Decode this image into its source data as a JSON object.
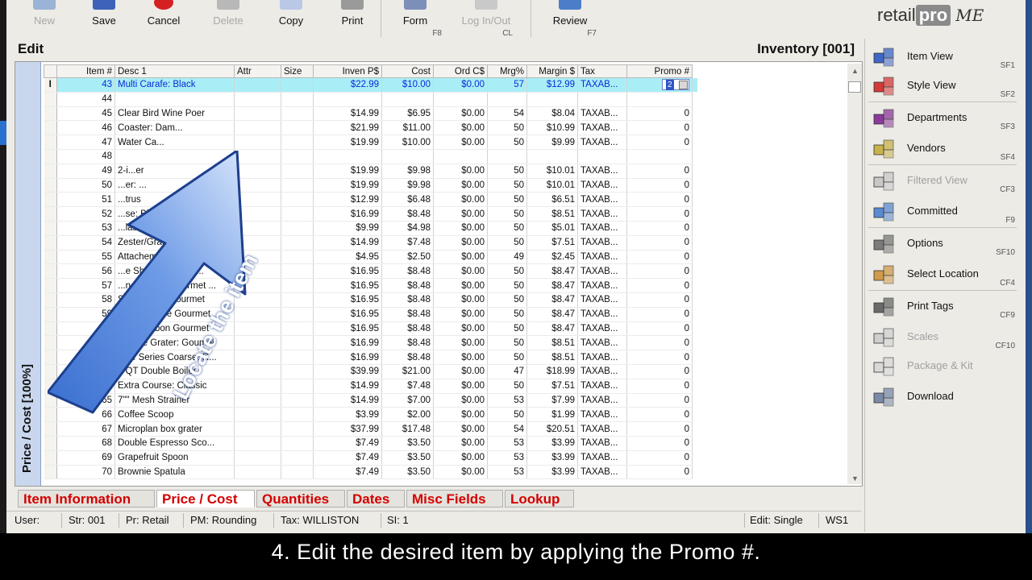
{
  "toolbar": {
    "buttons": [
      {
        "label": "New",
        "enabled": false,
        "icon": "new-icon",
        "key": ""
      },
      {
        "label": "Save",
        "enabled": true,
        "icon": "save-icon",
        "key": ""
      },
      {
        "label": "Cancel",
        "enabled": true,
        "icon": "cancel-icon",
        "key": ""
      },
      {
        "label": "Delete",
        "enabled": false,
        "icon": "delete-icon",
        "key": ""
      },
      {
        "label": "Copy",
        "enabled": true,
        "icon": "copy-icon",
        "key": ""
      },
      {
        "label": "Print",
        "enabled": true,
        "icon": "print-icon",
        "key": ""
      },
      {
        "label": "Form",
        "enabled": true,
        "icon": "form-icon",
        "key": "F8"
      },
      {
        "label": "Log In/Out",
        "enabled": false,
        "icon": "login-icon",
        "key": "CL"
      },
      {
        "label": "Review",
        "enabled": true,
        "icon": "review-icon",
        "key": "F7"
      }
    ]
  },
  "logo": {
    "retail": "retail",
    "pro": "pro",
    "me": "ME"
  },
  "edit_bar": {
    "title": "Edit",
    "context": "Inventory [001]"
  },
  "vertical_tab": "Price / Cost [100%]",
  "grid": {
    "columns": [
      "Item #",
      "Desc 1",
      "Attr",
      "Size",
      "Inven P$",
      "Cost",
      "Ord C$",
      "Mrg%",
      "Margin $",
      "Tax",
      "Promo #"
    ],
    "selected_row_marker": "I",
    "rows": [
      [
        "43",
        "Multi Carafe: Black",
        "",
        "",
        "$22.99",
        "$10.00",
        "$0.00",
        "57",
        "$12.99",
        "TAXAB...",
        "2"
      ],
      [
        "44",
        "",
        "",
        "",
        "",
        "",
        "",
        "",
        "",
        "",
        ""
      ],
      [
        "45",
        "Clear Bird Wine Poer",
        "",
        "",
        "$14.99",
        "$6.95",
        "$0.00",
        "54",
        "$8.04",
        "TAXAB...",
        "0"
      ],
      [
        "46",
        "Coaster: Dam...",
        "",
        "",
        "$21.99",
        "$11.00",
        "$0.00",
        "50",
        "$10.99",
        "TAXAB...",
        "0"
      ],
      [
        "47",
        "Water Ca...",
        "",
        "",
        "$19.99",
        "$10.00",
        "$0.00",
        "50",
        "$9.99",
        "TAXAB...",
        "0"
      ],
      [
        "48",
        "",
        "",
        "",
        "",
        "",
        "",
        "",
        "",
        "",
        ""
      ],
      [
        "49",
        "2-i...er",
        "",
        "",
        "$19.99",
        "$9.98",
        "$0.00",
        "50",
        "$10.01",
        "TAXAB...",
        "0"
      ],
      [
        "50",
        "...er: ...",
        "",
        "",
        "$19.99",
        "$9.98",
        "$0.00",
        "50",
        "$10.01",
        "TAXAB...",
        "0"
      ],
      [
        "51",
        "...trus",
        "",
        "",
        "$12.99",
        "$6.48",
        "$0.00",
        "50",
        "$6.51",
        "TAXAB...",
        "0"
      ],
      [
        "52",
        "...se: Blk",
        "",
        "",
        "$16.99",
        "$8.48",
        "$0.00",
        "50",
        "$8.51",
        "TAXAB...",
        "0"
      ],
      [
        "53",
        "...lassic",
        "",
        "",
        "$9.99",
        "$4.98",
        "$0.00",
        "50",
        "$5.01",
        "TAXAB...",
        "0"
      ],
      [
        "54",
        "Zester/Grater",
        "",
        "",
        "$14.99",
        "$7.48",
        "$0.00",
        "50",
        "$7.51",
        "TAXAB...",
        "0"
      ],
      [
        "55",
        "Attachement: ...",
        "",
        "",
        "$4.95",
        "$2.50",
        "$0.00",
        "49",
        "$2.45",
        "TAXAB...",
        "0"
      ],
      [
        "56",
        "...e Shaver: Gourm...",
        "",
        "",
        "$16.95",
        "$8.48",
        "$0.00",
        "50",
        "$8.47",
        "TAXAB...",
        "0"
      ],
      [
        "57",
        "...ne Grater: Gourmet ...",
        "",
        "",
        "$16.95",
        "$8.48",
        "$0.00",
        "50",
        "$8.47",
        "TAXAB...",
        "0"
      ],
      [
        "58",
        "Star Grater: Gourmet",
        "",
        "",
        "$16.95",
        "$8.48",
        "$0.00",
        "50",
        "$8.47",
        "TAXAB...",
        "0"
      ],
      [
        "59",
        "Extra Coarse Gourmet",
        "",
        "",
        "$16.95",
        "$8.48",
        "$0.00",
        "50",
        "$8.47",
        "TAXAB...",
        "0"
      ],
      [
        "60",
        "Med. Ribbon Gourmet",
        "",
        "",
        "$16.95",
        "$8.48",
        "$0.00",
        "50",
        "$8.47",
        "TAXAB...",
        "0"
      ],
      [
        "61",
        "Coarse Grater: Goumet",
        "",
        "",
        "$16.99",
        "$8.48",
        "$0.00",
        "50",
        "$8.51",
        "TAXAB...",
        "0"
      ],
      [
        "62",
        "Elite Series Coarse: R...",
        "",
        "",
        "$16.99",
        "$8.48",
        "$0.00",
        "50",
        "$8.51",
        "TAXAB...",
        "0"
      ],
      [
        "63",
        "2 QT Double Boiler",
        "",
        "",
        "$39.99",
        "$21.00",
        "$0.00",
        "47",
        "$18.99",
        "TAXAB...",
        "0"
      ],
      [
        "64",
        "Extra Course: Classic",
        "",
        "",
        "$14.99",
        "$7.48",
        "$0.00",
        "50",
        "$7.51",
        "TAXAB...",
        "0"
      ],
      [
        "65",
        "7\"\" Mesh Strainer",
        "",
        "",
        "$14.99",
        "$7.00",
        "$0.00",
        "53",
        "$7.99",
        "TAXAB...",
        "0"
      ],
      [
        "66",
        "Coffee Scoop",
        "",
        "",
        "$3.99",
        "$2.00",
        "$0.00",
        "50",
        "$1.99",
        "TAXAB...",
        "0"
      ],
      [
        "67",
        "Microplan box grater",
        "",
        "",
        "$37.99",
        "$17.48",
        "$0.00",
        "54",
        "$20.51",
        "TAXAB...",
        "0"
      ],
      [
        "68",
        "Double Espresso Sco...",
        "",
        "",
        "$7.49",
        "$3.50",
        "$0.00",
        "53",
        "$3.99",
        "TAXAB...",
        "0"
      ],
      [
        "69",
        "Grapefruit Spoon",
        "",
        "",
        "$7.49",
        "$3.50",
        "$0.00",
        "53",
        "$3.99",
        "TAXAB...",
        "0"
      ],
      [
        "70",
        "Brownie Spatula",
        "",
        "",
        "$7.49",
        "$3.50",
        "$0.00",
        "53",
        "$3.99",
        "TAXAB...",
        "0"
      ]
    ]
  },
  "overlay_text": "Locate the item",
  "tabs": [
    "Item Information",
    "Price / Cost",
    "Quantities",
    "Dates",
    "Misc Fields",
    "Lookup"
  ],
  "active_tab": "Price / Cost",
  "status_bar": {
    "user": "User:",
    "store": "Str: 001",
    "price_level": "Pr: Retail",
    "pm": "PM: Rounding",
    "tax": "Tax: WILLISTON",
    "si": "SI: 1",
    "mode": "Edit: Single",
    "ws": "WS1"
  },
  "side_panel": {
    "items": [
      {
        "label": "Item View",
        "key": "SF1",
        "enabled": true,
        "icon": "cubes-icon"
      },
      {
        "label": "Style View",
        "key": "SF2",
        "enabled": true,
        "icon": "rubiks-cube-icon"
      },
      {
        "label": "Departments",
        "key": "SF3",
        "enabled": true,
        "icon": "departments-icon"
      },
      {
        "label": "Vendors",
        "key": "SF4",
        "enabled": true,
        "icon": "vendor-icon"
      },
      {
        "label": "Filtered View",
        "key": "CF3",
        "enabled": false,
        "icon": "filter-icon"
      },
      {
        "label": "Committed",
        "key": "F9",
        "enabled": true,
        "icon": "committed-icon"
      },
      {
        "label": "Options",
        "key": "SF10",
        "enabled": true,
        "icon": "keyboard-icon"
      },
      {
        "label": "Select Location",
        "key": "CF4",
        "enabled": true,
        "icon": "location-icon"
      },
      {
        "label": "Print Tags",
        "key": "CF9",
        "enabled": true,
        "icon": "printer-icon"
      },
      {
        "label": "Scales",
        "key": "CF10",
        "enabled": false,
        "icon": "scales-icon"
      },
      {
        "label": "Package & Kit",
        "key": "",
        "enabled": false,
        "icon": "package-icon"
      },
      {
        "label": "Download",
        "key": "",
        "enabled": true,
        "icon": "download-icon"
      }
    ]
  },
  "caption": "4. Edit the desired item by applying the Promo #."
}
